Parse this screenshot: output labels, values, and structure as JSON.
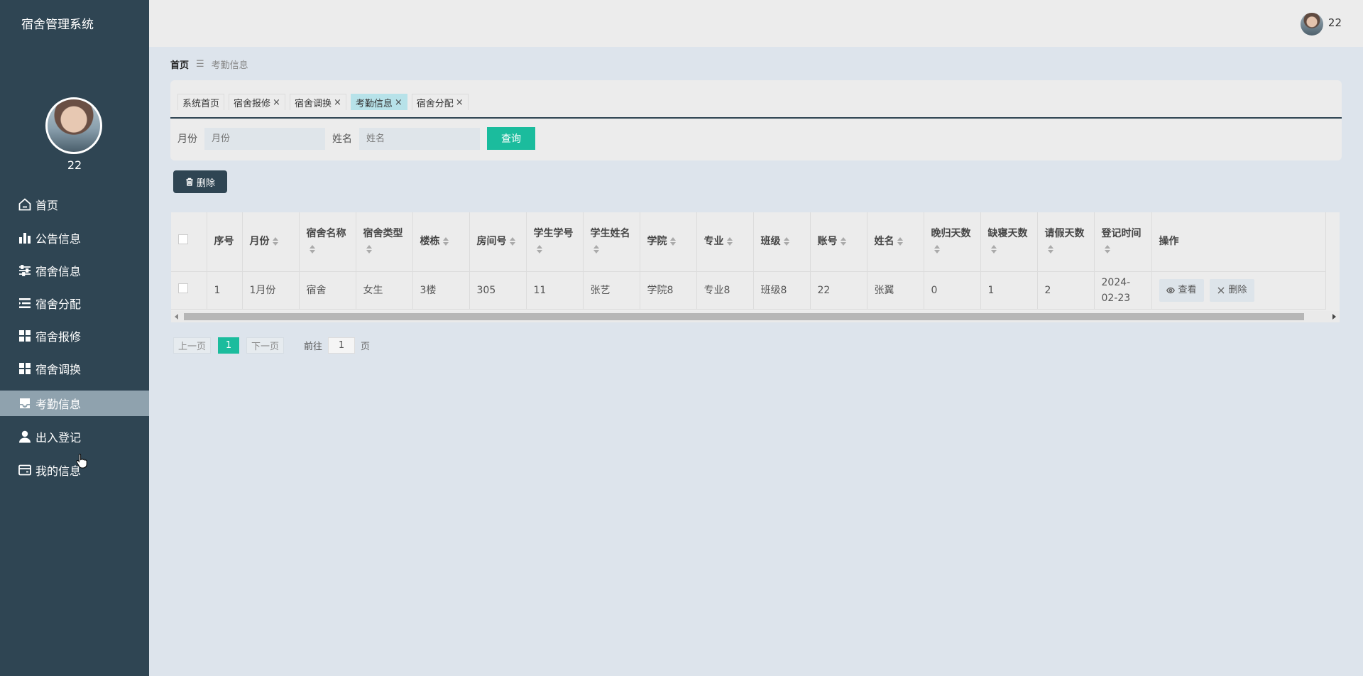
{
  "app": {
    "title": "宿舍管理系统"
  },
  "sidebar": {
    "username": "22",
    "items": [
      {
        "label": "首页",
        "icon": "home-icon",
        "active": false
      },
      {
        "label": "公告信息",
        "icon": "bar-chart-icon",
        "active": false
      },
      {
        "label": "宿舍信息",
        "icon": "sliders-icon",
        "active": false
      },
      {
        "label": "宿舍分配",
        "icon": "list-icon",
        "active": false
      },
      {
        "label": "宿舍报修",
        "icon": "grid-icon",
        "active": false
      },
      {
        "label": "宿舍调换",
        "icon": "grid-icon",
        "active": false
      },
      {
        "label": "考勤信息",
        "icon": "inbox-icon",
        "active": true
      },
      {
        "label": "出入登记",
        "icon": "user-icon",
        "active": false
      },
      {
        "label": "我的信息",
        "icon": "card-icon",
        "active": false
      }
    ]
  },
  "header": {
    "username": "22"
  },
  "breadcrumb": {
    "home": "首页",
    "separator": "☰",
    "current": "考勤信息"
  },
  "tabs": [
    {
      "label": "系统首页",
      "closable": false,
      "active": false
    },
    {
      "label": "宿舍报修",
      "closable": true,
      "active": false
    },
    {
      "label": "宿舍调换",
      "closable": true,
      "active": false
    },
    {
      "label": "考勤信息",
      "closable": true,
      "active": true
    },
    {
      "label": "宿舍分配",
      "closable": true,
      "active": false
    }
  ],
  "search": {
    "month_label": "月份",
    "month_placeholder": "月份",
    "name_label": "姓名",
    "name_placeholder": "姓名",
    "query_button": "查询"
  },
  "toolbar": {
    "delete_label": "删除"
  },
  "table": {
    "columns": [
      {
        "label": "序号",
        "sortable": false
      },
      {
        "label": "月份",
        "sortable": true
      },
      {
        "label": "宿舍名称",
        "sortable": true
      },
      {
        "label": "宿舍类型",
        "sortable": true
      },
      {
        "label": "楼栋",
        "sortable": true
      },
      {
        "label": "房间号",
        "sortable": true
      },
      {
        "label": "学生学号",
        "sortable": true
      },
      {
        "label": "学生姓名",
        "sortable": true
      },
      {
        "label": "学院",
        "sortable": true
      },
      {
        "label": "专业",
        "sortable": true
      },
      {
        "label": "班级",
        "sortable": true
      },
      {
        "label": "账号",
        "sortable": true
      },
      {
        "label": "姓名",
        "sortable": true
      },
      {
        "label": "晚归天数",
        "sortable": true
      },
      {
        "label": "缺寝天数",
        "sortable": true
      },
      {
        "label": "请假天数",
        "sortable": true
      },
      {
        "label": "登记时间",
        "sortable": true
      },
      {
        "label": "操作",
        "sortable": false
      }
    ],
    "rows": [
      [
        "1",
        "1月份",
        "宿舍",
        "女生",
        "3楼",
        "305",
        "11",
        "张艺",
        "学院8",
        "专业8",
        "班级8",
        "22",
        "张翼",
        "0",
        "1",
        "2",
        "2024-02-23"
      ]
    ],
    "view_label": "查看",
    "delete_label": "删除"
  },
  "pagination": {
    "prev": "上一页",
    "current": "1",
    "next": "下一页",
    "goto_label": "前往",
    "goto_value": "1",
    "page_label": "页"
  }
}
